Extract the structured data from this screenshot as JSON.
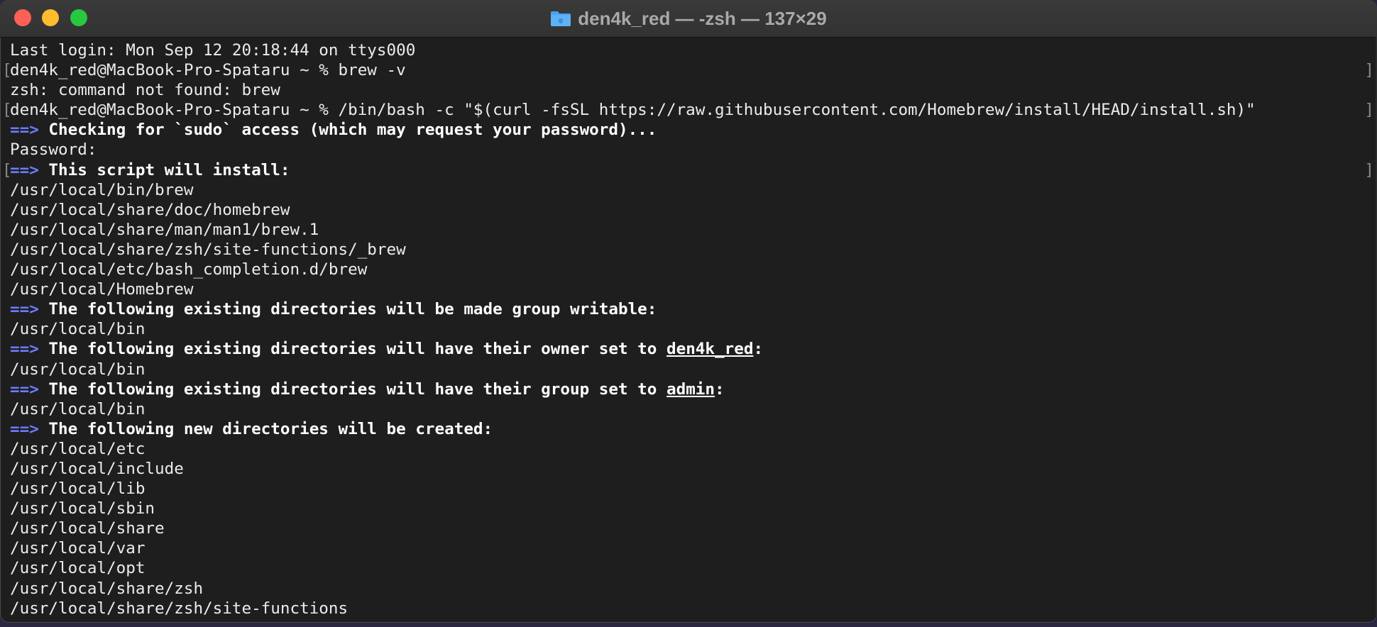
{
  "window": {
    "title": "den4k_red — -zsh — 137×29",
    "folder_icon": "folder-icon"
  },
  "colors": {
    "arrow": "#6b7cff",
    "background": "#1e1e1e",
    "text": "#ececec"
  },
  "terminal": {
    "line1": "Last login: Mon Sep 12 20:18:44 on ttys000",
    "line2": "den4k_red@MacBook-Pro-Spataru ~ % brew -v",
    "line3": "zsh: command not found: brew",
    "line4": "den4k_red@MacBook-Pro-Spataru ~ % /bin/bash -c \"$(curl -fsSL https://raw.githubusercontent.com/Homebrew/install/HEAD/install.sh)\"",
    "arrow": "==>",
    "line5": "Checking for `sudo` access (which may request your password)...",
    "line6": "Password:",
    "line7": "This script will install:",
    "line8": "/usr/local/bin/brew",
    "line9": "/usr/local/share/doc/homebrew",
    "line10": "/usr/local/share/man/man1/brew.1",
    "line11": "/usr/local/share/zsh/site-functions/_brew",
    "line12": "/usr/local/etc/bash_completion.d/brew",
    "line13": "/usr/local/Homebrew",
    "line14": "The following existing directories will be made group writable:",
    "line15": "/usr/local/bin",
    "line16_pre": "The following existing directories will have their owner set to ",
    "line16_user": "den4k_red",
    "line16_post": ":",
    "line17": "/usr/local/bin",
    "line18_pre": "The following existing directories will have their group set to ",
    "line18_group": "admin",
    "line18_post": ":",
    "line19": "/usr/local/bin",
    "line20": "The following new directories will be created:",
    "line21": "/usr/local/etc",
    "line22": "/usr/local/include",
    "line23": "/usr/local/lib",
    "line24": "/usr/local/sbin",
    "line25": "/usr/local/share",
    "line26": "/usr/local/var",
    "line27": "/usr/local/opt",
    "line28": "/usr/local/share/zsh",
    "line29": "/usr/local/share/zsh/site-functions",
    "bracket_left": "[",
    "bracket_right": "]"
  }
}
